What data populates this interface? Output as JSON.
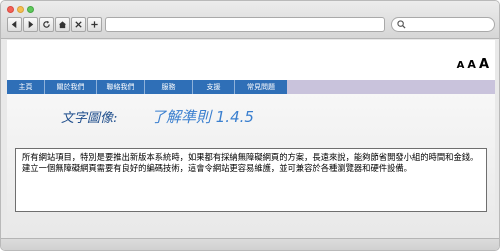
{
  "browser": {
    "url": "",
    "search_placeholder": ""
  },
  "header": {
    "font_small": "A",
    "font_medium": "A",
    "font_large": "A"
  },
  "nav": {
    "items": [
      {
        "label": "主頁"
      },
      {
        "label": "關於我們"
      },
      {
        "label": "聯絡我們"
      },
      {
        "label": "服務"
      },
      {
        "label": "支援"
      },
      {
        "label": "常見問題"
      }
    ]
  },
  "banner": {
    "prefix": "文字圖像:",
    "title": "了解準則 1.4.5"
  },
  "content": {
    "paragraph": "所有網站項目，特別是要推出新版本系統時，如果都有採納無障礙網頁的方案，長遠來說，能夠節省開發小組的時間和金錢。建立一個無障礙網頁需要有良好的編碼技術，這會令網站更容易維護，並可兼容於各種瀏覽器和硬件設備。"
  },
  "colors": {
    "menu_bg": "#2f6fb7",
    "menu_strip": "#c9c3dc",
    "banner_prefix": "#1f4e8c",
    "banner_title": "#3a7fcf"
  }
}
